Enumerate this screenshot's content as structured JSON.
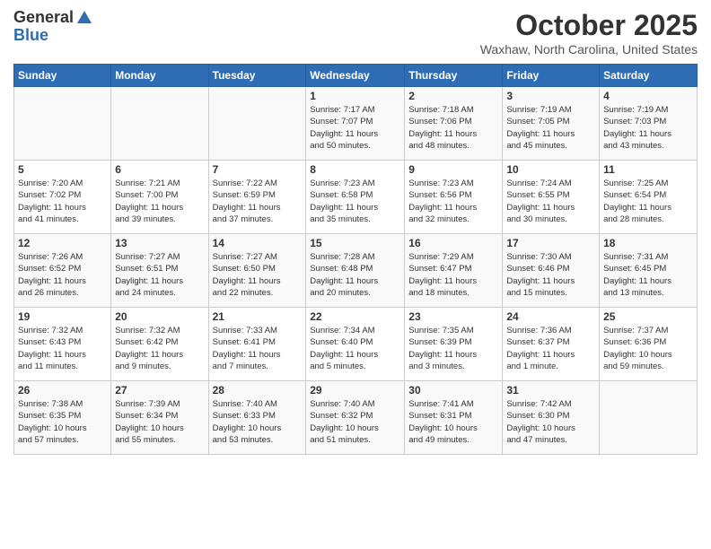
{
  "logo": {
    "general": "General",
    "blue": "Blue"
  },
  "header": {
    "month": "October 2025",
    "location": "Waxhaw, North Carolina, United States"
  },
  "weekdays": [
    "Sunday",
    "Monday",
    "Tuesday",
    "Wednesday",
    "Thursday",
    "Friday",
    "Saturday"
  ],
  "weeks": [
    [
      {
        "day": "",
        "info": ""
      },
      {
        "day": "",
        "info": ""
      },
      {
        "day": "",
        "info": ""
      },
      {
        "day": "1",
        "info": "Sunrise: 7:17 AM\nSunset: 7:07 PM\nDaylight: 11 hours\nand 50 minutes."
      },
      {
        "day": "2",
        "info": "Sunrise: 7:18 AM\nSunset: 7:06 PM\nDaylight: 11 hours\nand 48 minutes."
      },
      {
        "day": "3",
        "info": "Sunrise: 7:19 AM\nSunset: 7:05 PM\nDaylight: 11 hours\nand 45 minutes."
      },
      {
        "day": "4",
        "info": "Sunrise: 7:19 AM\nSunset: 7:03 PM\nDaylight: 11 hours\nand 43 minutes."
      }
    ],
    [
      {
        "day": "5",
        "info": "Sunrise: 7:20 AM\nSunset: 7:02 PM\nDaylight: 11 hours\nand 41 minutes."
      },
      {
        "day": "6",
        "info": "Sunrise: 7:21 AM\nSunset: 7:00 PM\nDaylight: 11 hours\nand 39 minutes."
      },
      {
        "day": "7",
        "info": "Sunrise: 7:22 AM\nSunset: 6:59 PM\nDaylight: 11 hours\nand 37 minutes."
      },
      {
        "day": "8",
        "info": "Sunrise: 7:23 AM\nSunset: 6:58 PM\nDaylight: 11 hours\nand 35 minutes."
      },
      {
        "day": "9",
        "info": "Sunrise: 7:23 AM\nSunset: 6:56 PM\nDaylight: 11 hours\nand 32 minutes."
      },
      {
        "day": "10",
        "info": "Sunrise: 7:24 AM\nSunset: 6:55 PM\nDaylight: 11 hours\nand 30 minutes."
      },
      {
        "day": "11",
        "info": "Sunrise: 7:25 AM\nSunset: 6:54 PM\nDaylight: 11 hours\nand 28 minutes."
      }
    ],
    [
      {
        "day": "12",
        "info": "Sunrise: 7:26 AM\nSunset: 6:52 PM\nDaylight: 11 hours\nand 26 minutes."
      },
      {
        "day": "13",
        "info": "Sunrise: 7:27 AM\nSunset: 6:51 PM\nDaylight: 11 hours\nand 24 minutes."
      },
      {
        "day": "14",
        "info": "Sunrise: 7:27 AM\nSunset: 6:50 PM\nDaylight: 11 hours\nand 22 minutes."
      },
      {
        "day": "15",
        "info": "Sunrise: 7:28 AM\nSunset: 6:48 PM\nDaylight: 11 hours\nand 20 minutes."
      },
      {
        "day": "16",
        "info": "Sunrise: 7:29 AM\nSunset: 6:47 PM\nDaylight: 11 hours\nand 18 minutes."
      },
      {
        "day": "17",
        "info": "Sunrise: 7:30 AM\nSunset: 6:46 PM\nDaylight: 11 hours\nand 15 minutes."
      },
      {
        "day": "18",
        "info": "Sunrise: 7:31 AM\nSunset: 6:45 PM\nDaylight: 11 hours\nand 13 minutes."
      }
    ],
    [
      {
        "day": "19",
        "info": "Sunrise: 7:32 AM\nSunset: 6:43 PM\nDaylight: 11 hours\nand 11 minutes."
      },
      {
        "day": "20",
        "info": "Sunrise: 7:32 AM\nSunset: 6:42 PM\nDaylight: 11 hours\nand 9 minutes."
      },
      {
        "day": "21",
        "info": "Sunrise: 7:33 AM\nSunset: 6:41 PM\nDaylight: 11 hours\nand 7 minutes."
      },
      {
        "day": "22",
        "info": "Sunrise: 7:34 AM\nSunset: 6:40 PM\nDaylight: 11 hours\nand 5 minutes."
      },
      {
        "day": "23",
        "info": "Sunrise: 7:35 AM\nSunset: 6:39 PM\nDaylight: 11 hours\nand 3 minutes."
      },
      {
        "day": "24",
        "info": "Sunrise: 7:36 AM\nSunset: 6:37 PM\nDaylight: 11 hours\nand 1 minute."
      },
      {
        "day": "25",
        "info": "Sunrise: 7:37 AM\nSunset: 6:36 PM\nDaylight: 10 hours\nand 59 minutes."
      }
    ],
    [
      {
        "day": "26",
        "info": "Sunrise: 7:38 AM\nSunset: 6:35 PM\nDaylight: 10 hours\nand 57 minutes."
      },
      {
        "day": "27",
        "info": "Sunrise: 7:39 AM\nSunset: 6:34 PM\nDaylight: 10 hours\nand 55 minutes."
      },
      {
        "day": "28",
        "info": "Sunrise: 7:40 AM\nSunset: 6:33 PM\nDaylight: 10 hours\nand 53 minutes."
      },
      {
        "day": "29",
        "info": "Sunrise: 7:40 AM\nSunset: 6:32 PM\nDaylight: 10 hours\nand 51 minutes."
      },
      {
        "day": "30",
        "info": "Sunrise: 7:41 AM\nSunset: 6:31 PM\nDaylight: 10 hours\nand 49 minutes."
      },
      {
        "day": "31",
        "info": "Sunrise: 7:42 AM\nSunset: 6:30 PM\nDaylight: 10 hours\nand 47 minutes."
      },
      {
        "day": "",
        "info": ""
      }
    ]
  ]
}
